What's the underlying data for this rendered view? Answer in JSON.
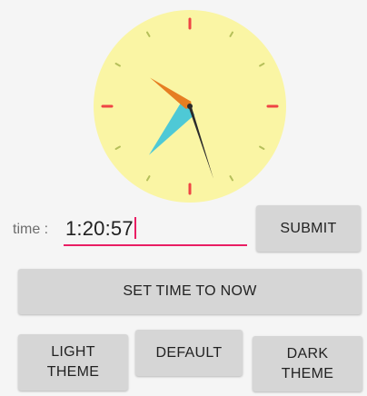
{
  "clock": {
    "face_color": "#faf5a4",
    "hour_tick_color": "#ef4444",
    "minute_tick_color": "#b5bf5a",
    "hour_hand_color": "#4ec9d6",
    "minute_hand_color": "#e67e22",
    "second_hand_color": "#2b2b2b",
    "time": {
      "hours": 1,
      "minutes": 20,
      "seconds": 57
    }
  },
  "time_input": {
    "label": "time :",
    "value": "1:20:57",
    "accent_color": "#e91e63"
  },
  "buttons": {
    "submit": "SUBMIT",
    "set_time_to_now": "SET TIME TO NOW",
    "light_theme": "LIGHT\nTHEME",
    "default": "DEFAULT",
    "dark_theme": "DARK\nTHEME"
  }
}
